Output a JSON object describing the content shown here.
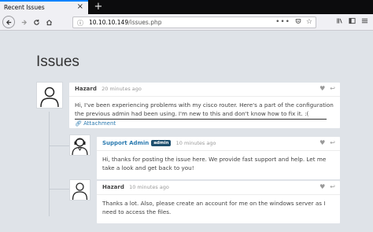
{
  "browser": {
    "tab_title": "Recent Issues",
    "tab_close": "×",
    "new_tab": "+",
    "url_host": "10.10.10.149",
    "url_path": "/issues.php",
    "url_more": "•••"
  },
  "page": {
    "title": "Issues"
  },
  "issues": [
    {
      "author": "Hazard",
      "time": "20 minutes ago",
      "body": "Hi, I've been experiencing problems with my cisco router. Here's a part of the configuration the previous admin had been using. I'm new to this and don't know how to fix it. :(",
      "attachment": "Attachment"
    },
    {
      "author": "Support Admin",
      "badge": "admin",
      "time": "10 minutes ago",
      "body": "Hi, thanks for posting the issue here. We provide fast support and help. Let me take a look and get back to you!"
    },
    {
      "author": "Hazard",
      "time": "10 minutes ago",
      "body": "Thanks a lot. Also, please create an account for me on the windows server as I need to access the files."
    }
  ],
  "colors": {
    "accent": "#0a84ff",
    "link": "#2a7ab0",
    "badge": "#1e4f6e",
    "page_bg": "#dfe3e8"
  },
  "icons": [
    "back-icon",
    "forward-icon",
    "reload-icon",
    "home-icon",
    "info-icon",
    "more-icon",
    "pocket-icon",
    "bookmark-star-icon",
    "library-icon",
    "sidebar-icon",
    "menu-icon",
    "heart-icon",
    "reply-icon",
    "paperclip-icon",
    "user-avatar-icon",
    "support-avatar-icon"
  ]
}
